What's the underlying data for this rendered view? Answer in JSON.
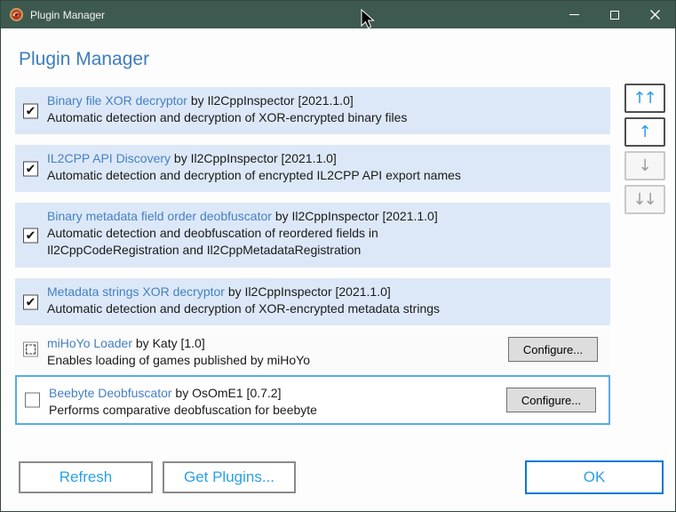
{
  "window": {
    "title": "Plugin Manager"
  },
  "header": {
    "title": "Plugin Manager"
  },
  "plugins": [
    {
      "name": "Binary file XOR decryptor",
      "byline": "by Il2CppInspector [2021.1.0]",
      "description": "Automatic detection and decryption of XOR-encrypted binary files",
      "checkbox_state": "checked",
      "check_glyph": "✔"
    },
    {
      "name": "IL2CPP API Discovery",
      "byline": "by Il2CppInspector [2021.1.0]",
      "description": "Automatic detection and decryption of encrypted IL2CPP API export names",
      "checkbox_state": "checked",
      "check_glyph": "✔"
    },
    {
      "name": "Binary metadata field order deobfuscator",
      "byline": "by Il2CppInspector [2021.1.0]",
      "description": "Automatic detection and deobfuscation of reordered fields in\nIl2CppCodeRegistration and Il2CppMetadataRegistration",
      "checkbox_state": "checked",
      "check_glyph": "✔"
    },
    {
      "name": "Metadata strings XOR decryptor",
      "byline": "by Il2CppInspector [2021.1.0]",
      "description": "Automatic detection and decryption of XOR-encrypted metadata strings",
      "checkbox_state": "checked",
      "check_glyph": "✔"
    },
    {
      "name": "miHoYo Loader",
      "byline": "by Katy [1.0]",
      "description": "Enables loading of games published by miHoYo",
      "checkbox_state": "indeterminate",
      "configure_label": "Configure..."
    },
    {
      "name": "Beebyte Deobfuscator",
      "byline": "by OsOmE1 [0.7.2]",
      "description": "Performs comparative deobfuscation for beebyte",
      "checkbox_state": "unchecked",
      "selected": true,
      "configure_label": "Configure..."
    }
  ],
  "reorder": [
    {
      "id": "move-to-top",
      "glyph": "↑↑",
      "enabled": true
    },
    {
      "id": "move-up",
      "glyph": "↑",
      "enabled": true
    },
    {
      "id": "move-down",
      "glyph": "↓",
      "enabled": false
    },
    {
      "id": "move-to-bottom",
      "glyph": "↓↓",
      "enabled": false
    }
  ],
  "footer": {
    "refresh_label": "Refresh",
    "get_plugins_label": "Get Plugins...",
    "ok_label": "OK"
  },
  "colors": {
    "titlebar": "#3e5a50",
    "heading_blue": "#3e7dbe",
    "link_blue": "#4580c4",
    "row_highlight": "#dce8f7",
    "selection_border": "#58ace0",
    "accent": "#0078d7",
    "button_text_blue": "#2aa0e8"
  }
}
